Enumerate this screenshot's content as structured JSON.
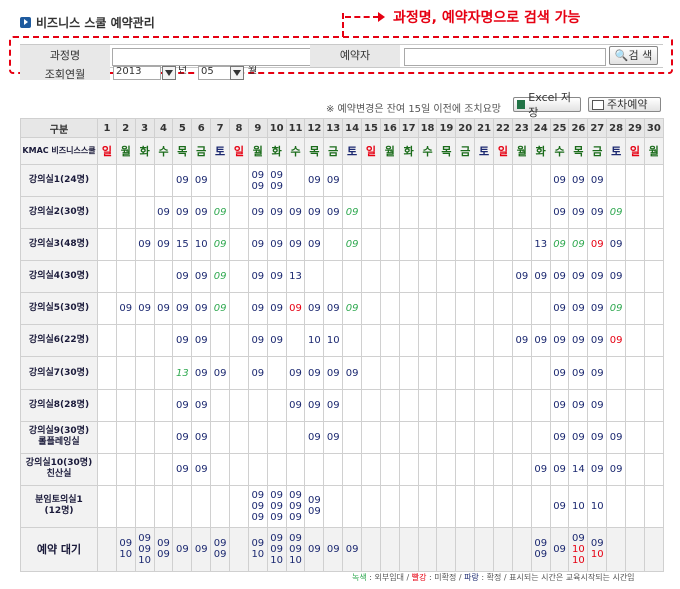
{
  "title": "비즈니스 스쿨 예약관리",
  "annotation": "과정명, 예약자명으로 검색 가능",
  "search": {
    "course_label": "과정명",
    "booker_label": "예약자",
    "button": "검 색"
  },
  "period": {
    "label": "조회연월",
    "year": "2013",
    "year_unit": "년",
    "month": "05",
    "month_unit": "월"
  },
  "notice": "※ 예약변경은 잔여 15일 이전에 조치요망",
  "buttons": {
    "excel": "Excel 저장",
    "print": "주차예약"
  },
  "table": {
    "corner": "구분",
    "kmac": "KMAC 비즈니스스쿨",
    "days": [
      "1",
      "2",
      "3",
      "4",
      "5",
      "6",
      "7",
      "8",
      "9",
      "10",
      "11",
      "12",
      "13",
      "14",
      "15",
      "16",
      "17",
      "18",
      "19",
      "20",
      "21",
      "22",
      "23",
      "24",
      "25",
      "26",
      "27",
      "28",
      "29",
      "30"
    ],
    "weekdays": [
      "일",
      "월",
      "화",
      "수",
      "목",
      "금",
      "토",
      "일",
      "월",
      "화",
      "수",
      "목",
      "금",
      "토",
      "일",
      "월",
      "화",
      "수",
      "목",
      "금",
      "토",
      "일",
      "월",
      "화",
      "수",
      "목",
      "금",
      "토",
      "일",
      "월"
    ],
    "rooms": [
      {
        "name": "강의실1(24명)",
        "cells": {
          "5": [
            "09"
          ],
          "6": [
            "09"
          ],
          "9": [
            "09",
            "09"
          ],
          "10": [
            "09",
            "09"
          ],
          "12": [
            "09"
          ],
          "13": [
            "09"
          ],
          "25": [
            "09"
          ],
          "26": [
            "09"
          ],
          "27": [
            "09"
          ]
        }
      },
      {
        "name": "강의실2(30명)",
        "cells": {
          "4": [
            "09"
          ],
          "5": [
            "09"
          ],
          "6": [
            "09"
          ],
          "7": [
            "09g"
          ],
          "9": [
            "09"
          ],
          "10": [
            "09"
          ],
          "11": [
            "09"
          ],
          "12": [
            "09"
          ],
          "13": [
            "09"
          ],
          "14": [
            "09g"
          ],
          "25": [
            "09"
          ],
          "26": [
            "09"
          ],
          "27": [
            "09"
          ],
          "28": [
            "09g"
          ]
        }
      },
      {
        "name": "강의실3(48명)",
        "cells": {
          "3": [
            "09"
          ],
          "4": [
            "09"
          ],
          "5": [
            "15"
          ],
          "6": [
            "10"
          ],
          "7": [
            "09g"
          ],
          "9": [
            "09"
          ],
          "10": [
            "09"
          ],
          "11": [
            "09"
          ],
          "12": [
            "09"
          ],
          "14": [
            "09g"
          ],
          "24": [
            "13"
          ],
          "25": [
            "09g"
          ],
          "26": [
            "09g"
          ],
          "27": [
            "09r"
          ],
          "28": [
            "09"
          ]
        }
      },
      {
        "name": "강의실4(30명)",
        "cells": {
          "5": [
            "09"
          ],
          "6": [
            "09"
          ],
          "7": [
            "09g"
          ],
          "9": [
            "09"
          ],
          "10": [
            "09"
          ],
          "11": [
            "13"
          ],
          "23": [
            "09"
          ],
          "24": [
            "09"
          ],
          "25": [
            "09"
          ],
          "26": [
            "09"
          ],
          "27": [
            "09"
          ],
          "28": [
            "09"
          ]
        }
      },
      {
        "name": "강의실5(30명)",
        "cells": {
          "2": [
            "09"
          ],
          "3": [
            "09"
          ],
          "4": [
            "09"
          ],
          "5": [
            "09"
          ],
          "6": [
            "09"
          ],
          "7": [
            "09g"
          ],
          "9": [
            "09"
          ],
          "10": [
            "09"
          ],
          "11": [
            "09r"
          ],
          "12": [
            "09"
          ],
          "13": [
            "09"
          ],
          "14": [
            "09g"
          ],
          "25": [
            "09"
          ],
          "26": [
            "09"
          ],
          "27": [
            "09"
          ],
          "28": [
            "09g"
          ]
        }
      },
      {
        "name": "강의실6(22명)",
        "cells": {
          "5": [
            "09"
          ],
          "6": [
            "09"
          ],
          "9": [
            "09"
          ],
          "10": [
            "09"
          ],
          "12": [
            "10"
          ],
          "13": [
            "10"
          ],
          "23": [
            "09"
          ],
          "24": [
            "09"
          ],
          "25": [
            "09"
          ],
          "26": [
            "09"
          ],
          "27": [
            "09"
          ],
          "28": [
            "09r"
          ]
        }
      },
      {
        "name": "강의실7(30명)",
        "cells": {
          "5": [
            "13g"
          ],
          "6": [
            "09"
          ],
          "7": [
            "09"
          ],
          "9": [
            "09"
          ],
          "11": [
            "09"
          ],
          "12": [
            "09"
          ],
          "13": [
            "09"
          ],
          "14": [
            "09"
          ],
          "25": [
            "09"
          ],
          "26": [
            "09"
          ],
          "27": [
            "09"
          ]
        }
      },
      {
        "name": "강의실8(28명)",
        "cells": {
          "5": [
            "09"
          ],
          "6": [
            "09"
          ],
          "11": [
            "09"
          ],
          "12": [
            "09"
          ],
          "13": [
            "09"
          ],
          "25": [
            "09"
          ],
          "26": [
            "09"
          ],
          "27": [
            "09"
          ]
        }
      },
      {
        "name": "강의실9(30명)\n롤플레잉실",
        "cells": {
          "5": [
            "09"
          ],
          "6": [
            "09"
          ],
          "12": [
            "09"
          ],
          "13": [
            "09"
          ],
          "25": [
            "09"
          ],
          "26": [
            "09"
          ],
          "27": [
            "09"
          ],
          "28": [
            "09"
          ]
        }
      },
      {
        "name": "강의실10(30명)\n친산실",
        "cells": {
          "5": [
            "09"
          ],
          "6": [
            "09"
          ],
          "24": [
            "09"
          ],
          "25": [
            "09"
          ],
          "26": [
            "14"
          ],
          "27": [
            "09"
          ],
          "28": [
            "09"
          ]
        }
      },
      {
        "name": "분임토의실1\n(12명)",
        "cells": {
          "9": [
            "09",
            "09",
            "09"
          ],
          "10": [
            "09",
            "09",
            "09"
          ],
          "11": [
            "09",
            "09",
            "09"
          ],
          "12": [
            "09",
            "09"
          ],
          "25": [
            "09"
          ],
          "26": [
            "10"
          ],
          "27": [
            "10"
          ]
        }
      }
    ],
    "wait": {
      "name": "예약 대기",
      "cells": {
        "2": [
          "09",
          "10"
        ],
        "3": [
          "09",
          "09",
          "10"
        ],
        "4": [
          "09",
          "09"
        ],
        "5": [
          "09"
        ],
        "6": [
          "09"
        ],
        "7": [
          "09",
          "09"
        ],
        "9": [
          "09",
          "10"
        ],
        "10": [
          "09",
          "09",
          "10"
        ],
        "11": [
          "09",
          "09",
          "10"
        ],
        "12": [
          "09"
        ],
        "13": [
          "09"
        ],
        "14": [
          "09"
        ],
        "24": [
          "09",
          "09"
        ],
        "25": [
          "09"
        ],
        "26": [
          "09",
          "10r",
          "10r"
        ],
        "27": [
          "09",
          "10r"
        ]
      }
    }
  },
  "legend": {
    "green": "녹색",
    "green_desc": " : 외부임대 /",
    "red": "빨강",
    "red_desc": " : 미확정 /",
    "blue": "파랑",
    "blue_desc": " : 확정 / 표시되는 시간은 교육시작되는 시간임"
  }
}
